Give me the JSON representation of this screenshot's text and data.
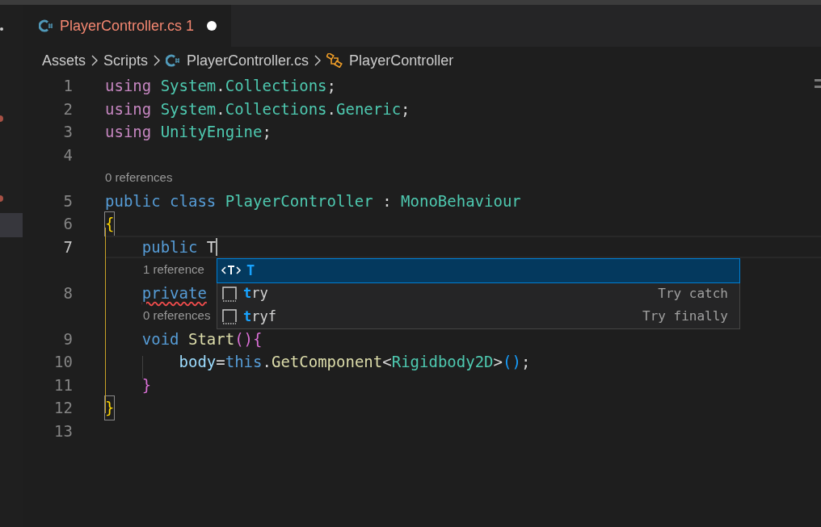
{
  "tab": {
    "label": "PlayerController.cs",
    "problems": "1",
    "modified": true,
    "selected": true
  },
  "breadcrumbs": [
    {
      "label": "Assets",
      "kind": "folder"
    },
    {
      "label": "Scripts",
      "kind": "folder"
    },
    {
      "label": "PlayerController.cs",
      "kind": "file"
    },
    {
      "label": "PlayerController",
      "kind": "class"
    }
  ],
  "lines": [
    {
      "kind": "code",
      "number": "1",
      "tokens": [
        {
          "text": "using ",
          "kind": "control"
        },
        {
          "text": "System",
          "kind": "type"
        },
        {
          "text": ".",
          "kind": "plain"
        },
        {
          "text": "Collections",
          "kind": "type"
        },
        {
          "text": ";",
          "kind": "plain"
        }
      ]
    },
    {
      "kind": "code",
      "number": "2",
      "tokens": [
        {
          "text": "using ",
          "kind": "control"
        },
        {
          "text": "System",
          "kind": "type"
        },
        {
          "text": ".",
          "kind": "plain"
        },
        {
          "text": "Collections",
          "kind": "type"
        },
        {
          "text": ".",
          "kind": "plain"
        },
        {
          "text": "Generic",
          "kind": "type"
        },
        {
          "text": ";",
          "kind": "plain"
        }
      ]
    },
    {
      "kind": "code",
      "number": "3",
      "tokens": [
        {
          "text": "using ",
          "kind": "control"
        },
        {
          "text": "UnityEngine",
          "kind": "type"
        },
        {
          "text": ";",
          "kind": "plain"
        }
      ]
    },
    {
      "kind": "code",
      "number": "4"
    },
    {
      "kind": "codelens",
      "text": "0 references"
    },
    {
      "kind": "code",
      "number": "5",
      "tokens": [
        {
          "text": "public class ",
          "kind": "keyword"
        },
        {
          "text": "PlayerController",
          "kind": "type"
        },
        {
          "text": " : ",
          "kind": "plain"
        },
        {
          "text": "MonoBehaviour",
          "kind": "type"
        }
      ]
    },
    {
      "kind": "code",
      "number": "6",
      "tokens": [
        {
          "text": "{",
          "kind": "bracket1",
          "matched": true
        }
      ]
    },
    {
      "kind": "code",
      "number": "7",
      "current": true,
      "tokens": [
        {
          "text": "    public",
          "kind": "keyword"
        },
        {
          "text": " T",
          "kind": "plain"
        }
      ]
    },
    {
      "kind": "codelens",
      "text": "1 reference",
      "indent": true
    },
    {
      "kind": "code",
      "number": "8",
      "tokens": [
        {
          "text": "    private",
          "kind": "keyword",
          "error": true
        }
      ]
    },
    {
      "kind": "codelens",
      "text": "0 references",
      "indent": true
    },
    {
      "kind": "code",
      "number": "9",
      "tokens": [
        {
          "text": "    void ",
          "kind": "keyword"
        },
        {
          "text": "Start",
          "kind": "func"
        },
        {
          "text": "(){",
          "kind": "bracket2"
        }
      ]
    },
    {
      "kind": "code",
      "number": "10",
      "tokens": [
        {
          "text": "        body",
          "kind": "var"
        },
        {
          "text": "=",
          "kind": "plain"
        },
        {
          "text": "this",
          "kind": "keyword"
        },
        {
          "text": ".",
          "kind": "plain"
        },
        {
          "text": "GetComponent",
          "kind": "func"
        },
        {
          "text": "<",
          "kind": "plain"
        },
        {
          "text": "Rigidbody2D",
          "kind": "type"
        },
        {
          "text": ">",
          "kind": "plain"
        },
        {
          "text": "()",
          "kind": "bracket3"
        },
        {
          "text": ";",
          "kind": "plain"
        }
      ]
    },
    {
      "kind": "code",
      "number": "11",
      "tokens": [
        {
          "text": "    }",
          "kind": "bracket2"
        }
      ]
    },
    {
      "kind": "code",
      "number": "12",
      "tokens": [
        {
          "text": "}",
          "kind": "bracket1",
          "matched": true
        }
      ]
    },
    {
      "kind": "code",
      "number": "13"
    }
  ],
  "suggestions": [
    {
      "kind": "type_parameter",
      "match": "T",
      "selected": true
    },
    {
      "kind": "snippet",
      "match": "t",
      "rest": "ry",
      "detail": "Try catch",
      "selected": false
    },
    {
      "kind": "snippet",
      "match": "t",
      "rest": "ryf",
      "detail": "Try finally",
      "selected": false
    }
  ]
}
